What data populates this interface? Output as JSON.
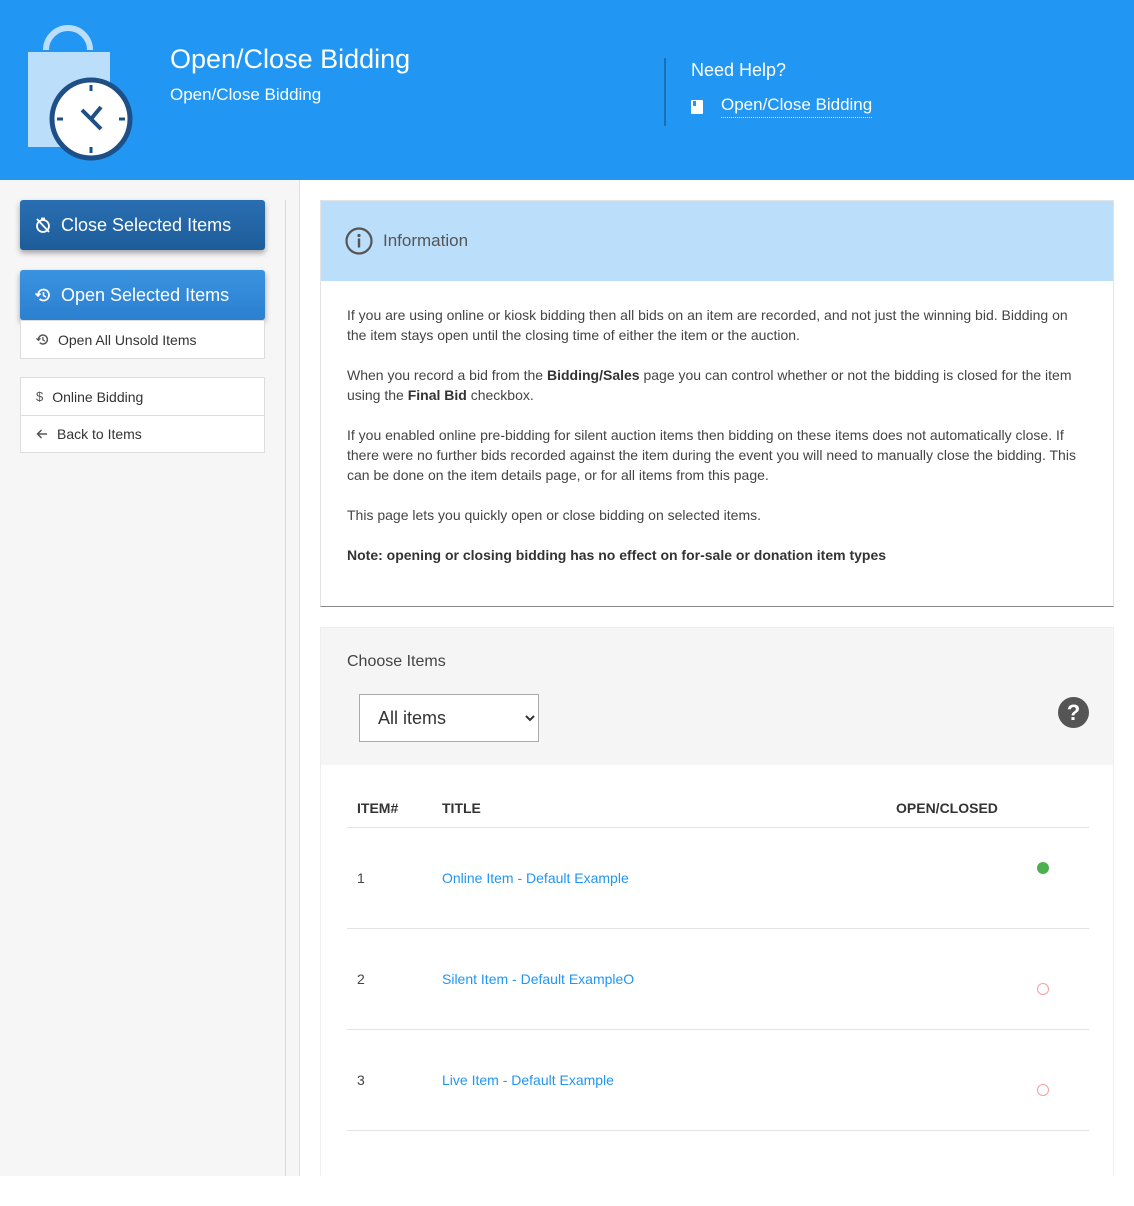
{
  "header": {
    "title": "Open/Close Bidding",
    "subtitle": "Open/Close Bidding",
    "help_title": "Need Help?",
    "help_link": "Open/Close Bidding",
    "logo_icon": "shopping-bag-clock-icon"
  },
  "sidebar": {
    "close_selected": "Close Selected Items",
    "open_selected": "Open Selected Items",
    "open_all_unsold": "Open All Unsold Items",
    "online_bidding": "Online Bidding",
    "back_to_items": "Back to Items"
  },
  "info": {
    "heading": "Information",
    "p1": "If you are using online or kiosk bidding then all bids on an item are recorded, and not just the winning bid. Bidding on the item stays open until the closing time of either the item or the auction.",
    "p2_a": "When you record a bid from the ",
    "p2_b": "Bidding/Sales",
    "p2_c": " page you can control whether or not the bidding is closed for the item using the ",
    "p2_d": "Final Bid",
    "p2_e": " checkbox.",
    "p3": "If you enabled online pre-bidding for silent auction items then bidding on these items does not automatically close. If there were no further bids recorded against the item during the event you will need to manually close the bidding. This can be done on the item details page, or for all items from this page.",
    "p4": "This page lets you quickly open or close bidding on selected items.",
    "note": "Note: opening or closing bidding has no effect on for-sale or donation item types"
  },
  "choose": {
    "title": "Choose Items",
    "select_value": "All items",
    "help_glyph": "?"
  },
  "table": {
    "headers": {
      "item": "ITEM#",
      "title": "TITLE",
      "status": "OPEN/CLOSED"
    },
    "rows": [
      {
        "num": "1",
        "title": "Online Item - Default Example",
        "status": "open"
      },
      {
        "num": "2",
        "title": "Silent Item - Default ExampleO",
        "status": "closed"
      },
      {
        "num": "3",
        "title": "Live Item - Default Example",
        "status": "closed"
      }
    ]
  },
  "colors": {
    "header_bg": "#2196f3",
    "info_bg": "#bbdefb",
    "link": "#2196f3",
    "open_dot": "#4caf50"
  }
}
